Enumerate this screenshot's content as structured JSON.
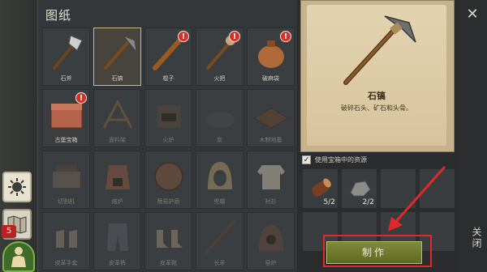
{
  "panel": {
    "title": "图纸"
  },
  "side": {
    "map_badge": "5"
  },
  "blueprints": [
    {
      "label": "石斧",
      "alert": false,
      "dim": false,
      "icon": "stone-axe-icon"
    },
    {
      "label": "石镐",
      "alert": false,
      "dim": false,
      "selected": true,
      "icon": "stone-pickaxe-icon"
    },
    {
      "label": "棍子",
      "alert": true,
      "dim": false,
      "icon": "club-icon"
    },
    {
      "label": "火把",
      "alert": true,
      "dim": false,
      "icon": "torch-icon"
    },
    {
      "label": "破麻袋",
      "alert": true,
      "dim": false,
      "icon": "sack-icon"
    },
    {
      "label": "古堡宝箱",
      "alert": true,
      "dim": false,
      "icon": "chest-icon"
    },
    {
      "label": "面料架",
      "alert": false,
      "dim": true,
      "icon": "drying-rack-icon"
    },
    {
      "label": "火炉",
      "alert": false,
      "dim": true,
      "icon": "forge-icon"
    },
    {
      "label": "炭",
      "alert": false,
      "dim": true,
      "icon": "charcoal-icon"
    },
    {
      "label": "木制地基",
      "alert": false,
      "dim": true,
      "icon": "wood-foundation-icon"
    },
    {
      "label": "切割机",
      "alert": false,
      "dim": true,
      "icon": "cutter-icon"
    },
    {
      "label": "熔炉",
      "alert": false,
      "dim": true,
      "icon": "furnace-icon"
    },
    {
      "label": "簡易护盾",
      "alert": false,
      "dim": true,
      "icon": "shield-icon"
    },
    {
      "label": "兜帽",
      "alert": false,
      "dim": true,
      "icon": "hood-icon"
    },
    {
      "label": "衬衫",
      "alert": false,
      "dim": true,
      "icon": "shirt-icon"
    },
    {
      "label": "皮革手套",
      "alert": false,
      "dim": true,
      "icon": "gloves-icon"
    },
    {
      "label": "皮革裤",
      "alert": false,
      "dim": true,
      "icon": "pants-icon"
    },
    {
      "label": "皮革靴",
      "alert": false,
      "dim": true,
      "icon": "boots-icon"
    },
    {
      "label": "长矛",
      "alert": false,
      "dim": true,
      "icon": "spear-icon"
    },
    {
      "label": "窑炉",
      "alert": false,
      "dim": true,
      "icon": "kiln-icon"
    }
  ],
  "detail": {
    "name": "石镐",
    "description": "破碎石头、矿石和头骨。"
  },
  "options": {
    "use_chest_label": "使用宝箱中的资源",
    "checked": true
  },
  "materials": [
    {
      "name": "log",
      "count": "5/2",
      "icon": "log-icon"
    },
    {
      "name": "stone",
      "count": "2/2",
      "icon": "stone-icon"
    }
  ],
  "actions": {
    "make_label": "制作",
    "close_label": "关闭",
    "close_x": "✕"
  }
}
